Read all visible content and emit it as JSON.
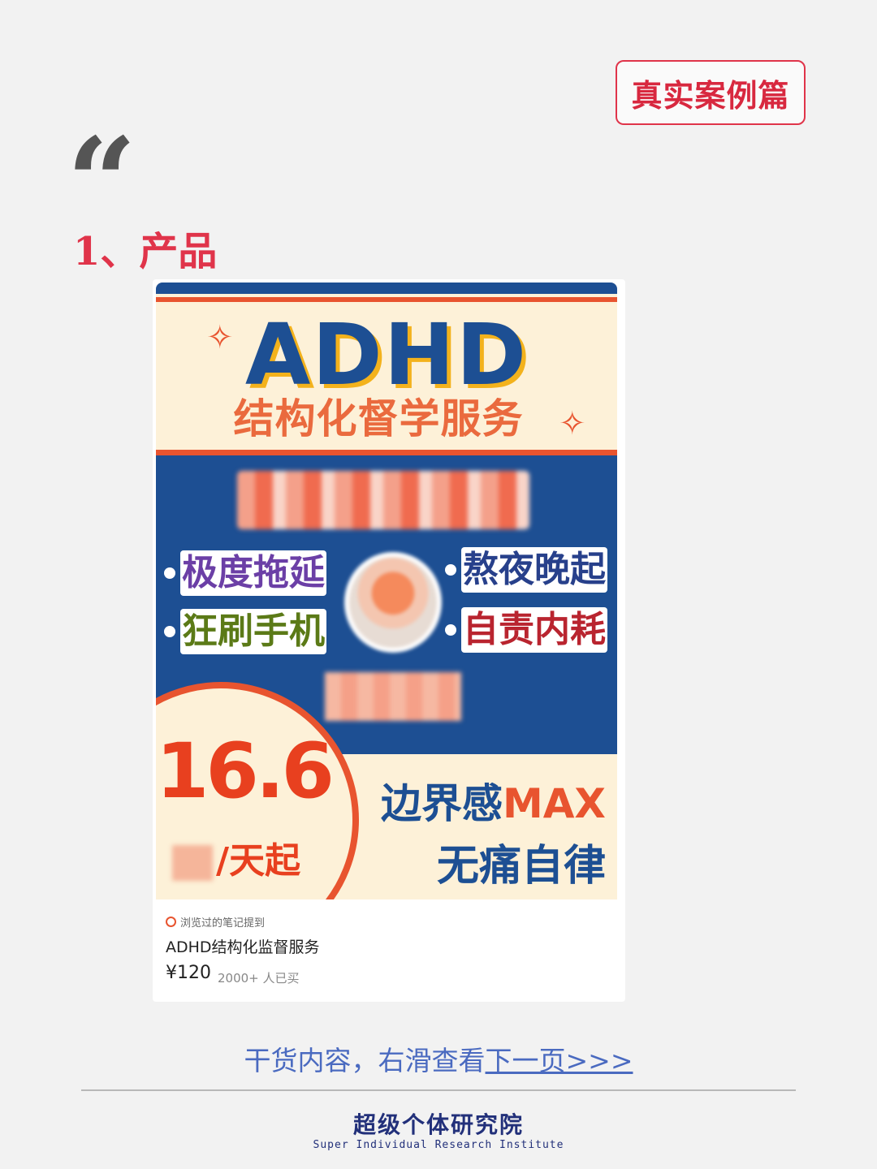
{
  "badge": "真实案例篇",
  "quote_mark": "“",
  "section_title": "1、产品",
  "poster": {
    "headline": "ADHD",
    "subheadline": "结构化督学服务",
    "pain_points": [
      "极度拖延",
      "熬夜晚起",
      "狂刷手机",
      "自责内耗"
    ],
    "price": "16.6",
    "price_unit": "/天起",
    "slogan_line1": "边界感",
    "slogan_line1_accent": "MAX",
    "slogan_line2": "无痛自律",
    "colors": {
      "blue": "#1d4f93",
      "orange": "#e8542f",
      "cream": "#fdf1d8"
    }
  },
  "card": {
    "note": "浏览过的笔记提到",
    "name": "ADHD结构化监督服务",
    "price": "¥120",
    "sold": "2000+ 人已买"
  },
  "footer": {
    "swipe_text": "干货内容，右滑查看",
    "swipe_link": "下一页>>>",
    "brand_cn": "超级个体研究院",
    "brand_en": "Super Individual Research Institute"
  }
}
